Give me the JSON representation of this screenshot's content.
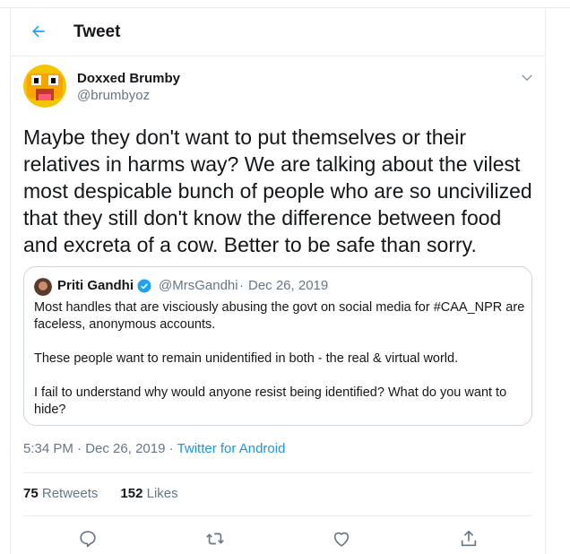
{
  "header": {
    "title": "Tweet",
    "back_icon": "back-arrow-icon"
  },
  "tweet": {
    "author_name": "Doxxed Brumby",
    "author_handle": "@brumbyoz",
    "text": "Maybe they don't want to put themselves or their relatives in harms way? We are talking about the vilest most despicable bunch of people who are so uncivilized that they still don't know the difference between food and excreta of a cow. Better to be safe than sorry.",
    "time": "5:34 PM",
    "date": "Dec 26, 2019",
    "source": "Twitter for Android",
    "retweets_count": "75",
    "retweets_label": "Retweets",
    "likes_count": "152",
    "likes_label": "Likes"
  },
  "quote": {
    "name": "Priti Gandhi",
    "handle": "@MrsGandhi",
    "separator": "·",
    "date": "Dec 26, 2019",
    "para1": "Most handles that are visciously abusing the govt on social media for #CAA_NPR are faceless, anonymous accounts.",
    "para2": "These people want to remain unidentified in both - the real & virtual world.",
    "para3": "I fail to understand why would anyone resist being identified? What do you want to hide?"
  },
  "meta_separator": "·",
  "icons": [
    "back-arrow-icon",
    "chevron-down-icon",
    "verified-badge-icon",
    "reply-icon",
    "retweet-icon",
    "like-icon",
    "share-icon"
  ],
  "colors": {
    "accent": "#1da1f2",
    "link": "#1b95e0",
    "secondary_text": "#657786",
    "border": "#e6ecf0"
  }
}
